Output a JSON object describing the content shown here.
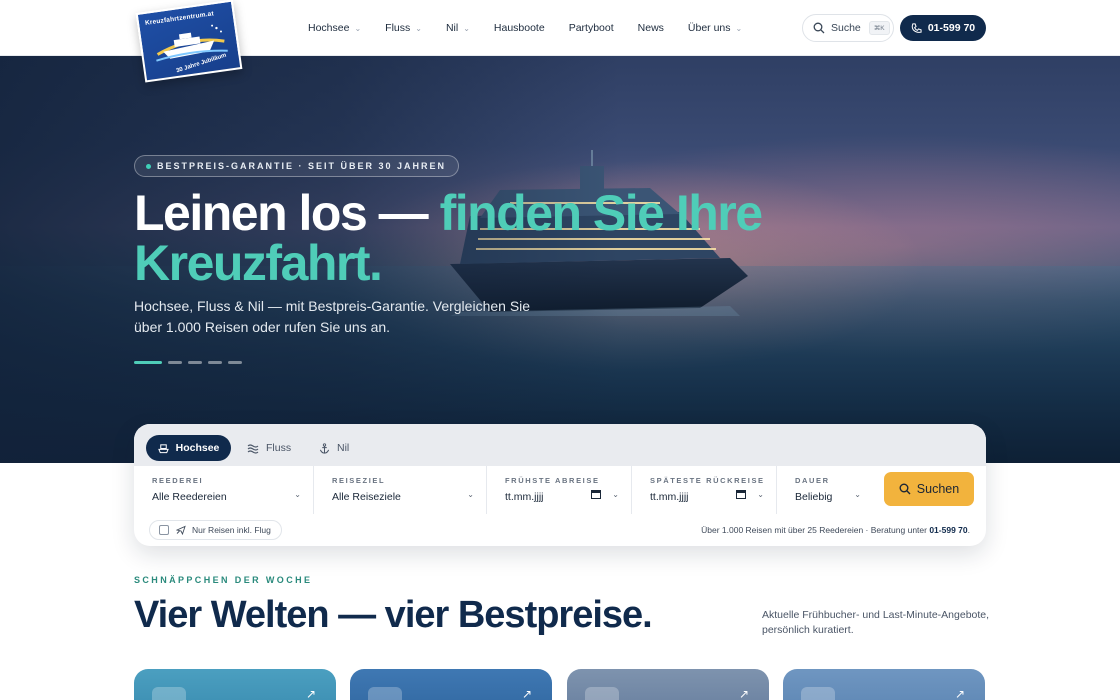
{
  "logo": {
    "top_text": "Kreuzfahrtzentrum.at",
    "bottom_text": "30 Jahre Jubiläum"
  },
  "nav": {
    "items": [
      {
        "label": "Hochsee",
        "dropdown": true
      },
      {
        "label": "Fluss",
        "dropdown": true
      },
      {
        "label": "Nil",
        "dropdown": true
      },
      {
        "label": "Hausboote",
        "dropdown": false
      },
      {
        "label": "Partyboot",
        "dropdown": false
      },
      {
        "label": "News",
        "dropdown": false
      },
      {
        "label": "Über uns",
        "dropdown": true
      }
    ],
    "search_label": "Suche",
    "search_shortcut": "⌘K",
    "phone": "01-599 70"
  },
  "hero": {
    "badge": "BESTPREIS-GARANTIE · SEIT ÜBER 30 JAHREN",
    "headline_plain": "Leinen los — ",
    "headline_accent": "finden Sie Ihre Kreuzfahrt.",
    "subline": "Hochsee, Fluss & Nil — mit Bestpreis-Garantie. Vergleichen Sie über 1.000 Reisen oder rufen Sie uns an.",
    "slides": 5,
    "active_slide": 1
  },
  "search_panel": {
    "tabs": [
      {
        "label": "Hochsee",
        "icon": "ship-icon",
        "active": true
      },
      {
        "label": "Fluss",
        "icon": "waves-icon",
        "active": false
      },
      {
        "label": "Nil",
        "icon": "anchor-icon",
        "active": false
      }
    ],
    "fields": [
      {
        "label": "REEDEREI",
        "value": "Alle Reedereien",
        "type": "select"
      },
      {
        "label": "REISEZIEL",
        "value": "Alle Reiseziele",
        "type": "select"
      },
      {
        "label": "FRÜHSTE ABREISE",
        "value": "tt.mm.jjjj",
        "type": "date"
      },
      {
        "label": "SPÄTESTE RÜCKREISE",
        "value": "tt.mm.jjjj",
        "type": "date"
      },
      {
        "label": "DAUER",
        "value": "Beliebig",
        "type": "select"
      }
    ],
    "submit_label": "Suchen",
    "flight_checkbox_label": "Nur Reisen inkl. Flug",
    "flight_checked": false,
    "info_text": "Über 1.000 Reisen mit über 25 Reedereien · Beratung unter ",
    "info_phone": "01-599 70",
    "info_suffix": "."
  },
  "section": {
    "eyebrow": "SCHNÄPPCHEN DER WOCHE",
    "title": "Vier Welten — vier Bestpreise.",
    "description": "Aktuelle Frühbucher- und Last-Minute-Angebote, persönlich kuratiert."
  },
  "colors": {
    "navy": "#102a4c",
    "accent_teal": "#4fcdb8",
    "cta_yellow": "#f2b33d",
    "eyebrow_teal": "#2a8a7c"
  }
}
